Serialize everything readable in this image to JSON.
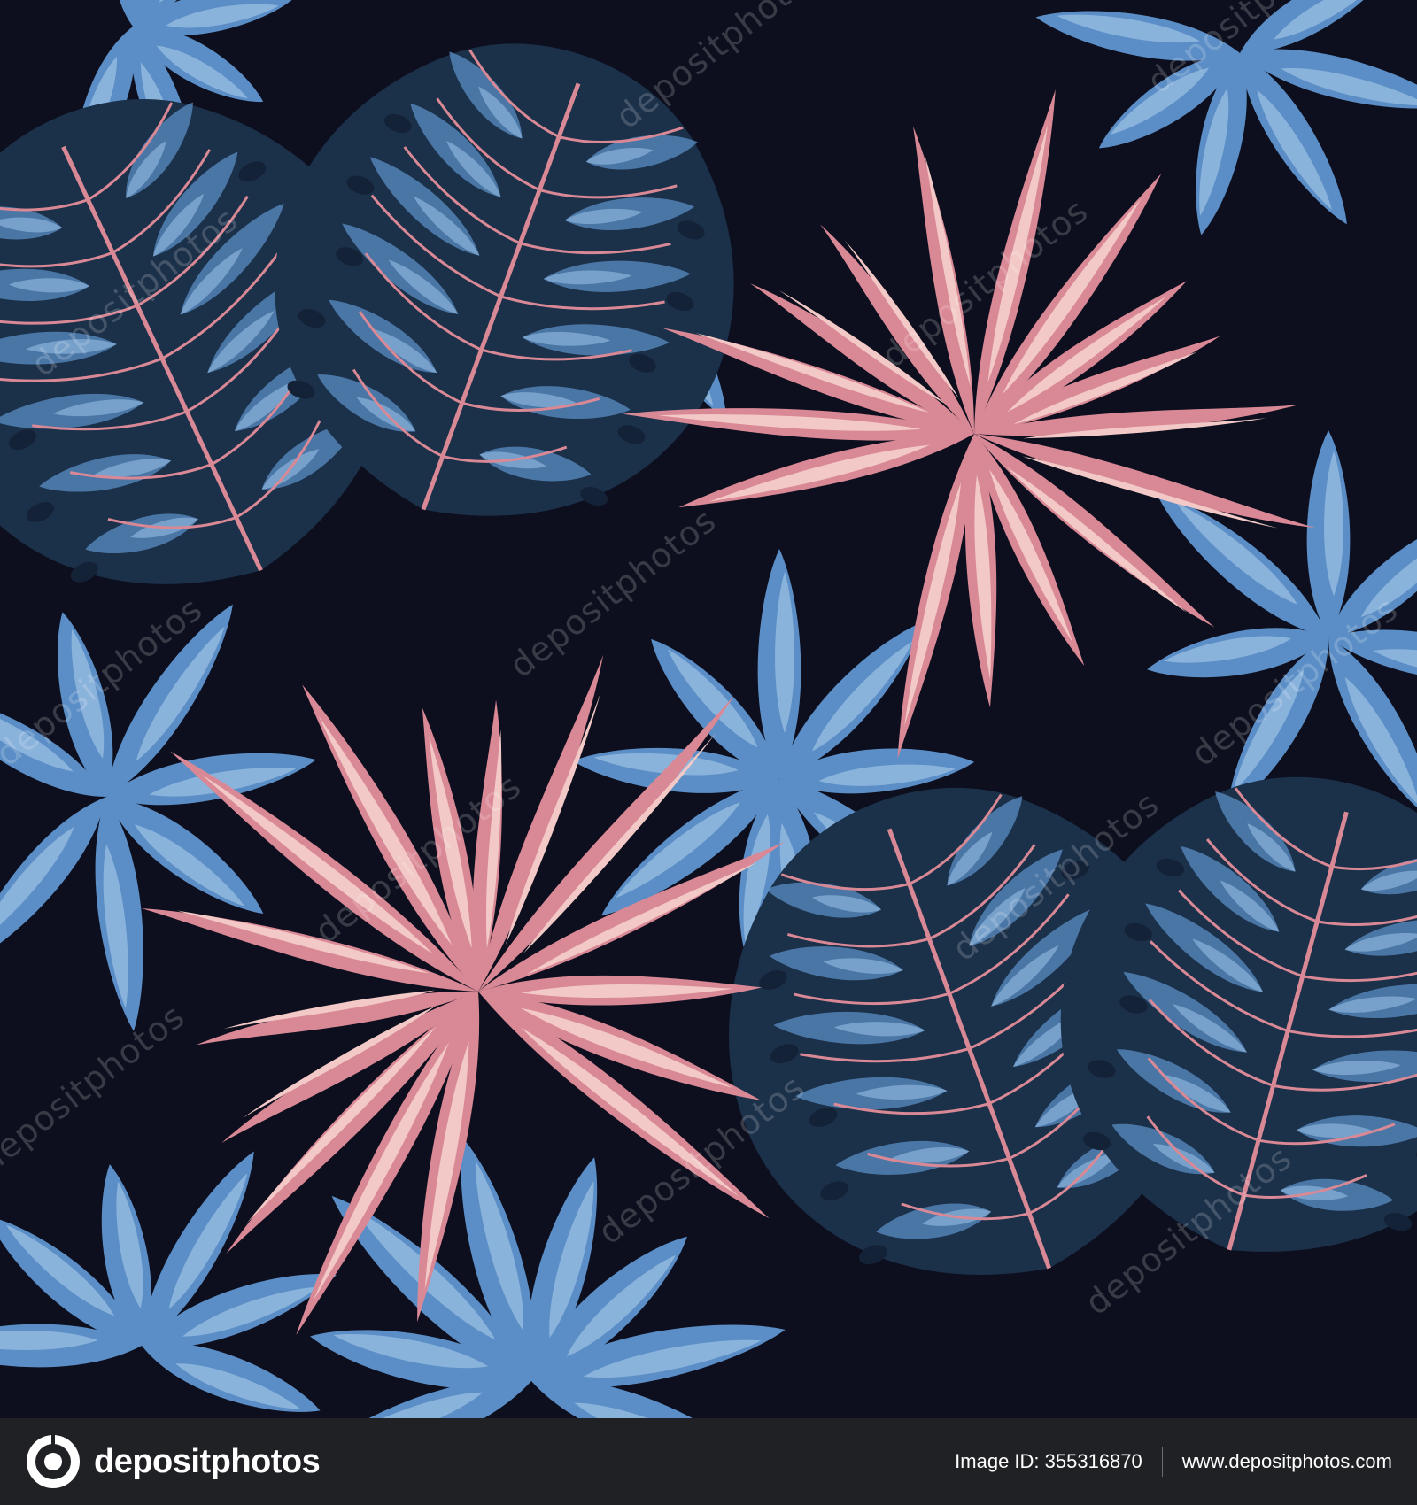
{
  "artwork": {
    "palette": {
      "background": "#0d0f1e",
      "navy_leaf": "#1b3049",
      "navy_leaf_dark": "#142238",
      "blue_leaf": "#5b8ec6",
      "blue_leaf_light": "#8ab3dc",
      "pink_leaf": "#d98895",
      "pink_leaf_light": "#f2c9c6",
      "pink_vein": "#d98895"
    },
    "watermark_text": "depositphotos",
    "watermark_icon": "camera-icon"
  },
  "footer": {
    "brand_logo_icon": "depositphotos-logo-icon",
    "brand_name": "depositphotos",
    "image_id_text": "Image ID: 355316870",
    "site_url": "www.depositphotos.com"
  }
}
